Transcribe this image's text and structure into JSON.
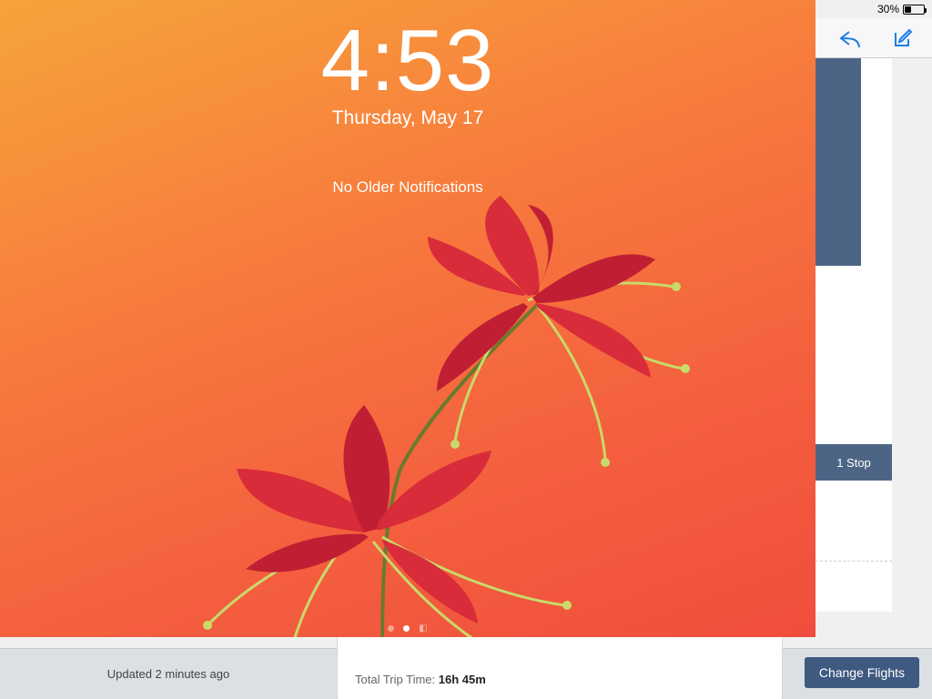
{
  "status": {
    "battery_pct": "30%",
    "battery_fill_pct": 30
  },
  "side": {
    "stop_badge": "1 Stop"
  },
  "bottom": {
    "updated_text": "Updated 2 minutes ago",
    "trip_label": "Total Trip Time: ",
    "trip_value": "16h 45m",
    "change_button": "Change Flights"
  },
  "lockscreen": {
    "time": "4:53",
    "date": "Thursday, May 17",
    "notif": "No Older Notifications"
  }
}
